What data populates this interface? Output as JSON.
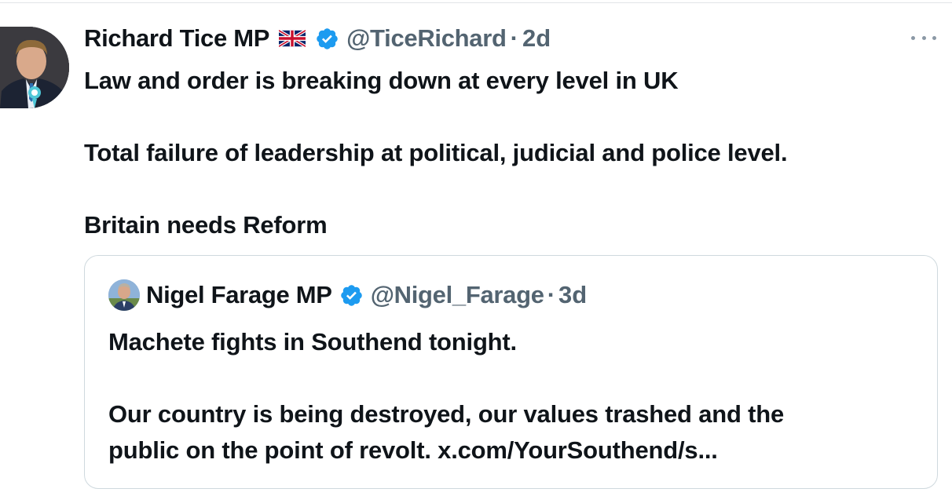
{
  "tweet": {
    "author_name": "Richard Tice MP",
    "handle": "@TiceRichard",
    "separator": "·",
    "time": "2d",
    "flag_icon": "uk-flag-icon",
    "verified_icon": "verified-badge-icon",
    "verified_color": "#1d9bf0",
    "more_icon": "more-options-icon",
    "text_lines": [
      "Law and order is breaking down at every level in UK",
      "Total failure of leadership at political, judicial and police level.",
      "Britain needs Reform"
    ]
  },
  "quote": {
    "author_name": "Nigel Farage MP",
    "handle": "@Nigel_Farage",
    "separator": "·",
    "time": "3d",
    "verified_icon": "verified-badge-icon",
    "text_lines": [
      "Machete fights in Southend tonight.",
      "Our country is being destroyed, our values trashed and the",
      "public on the point of revolt. x.com/YourSouthend/s..."
    ]
  },
  "colors": {
    "text": "#0f1419",
    "secondary_text": "#536471",
    "border": "#cfd9de",
    "verified": "#1d9bf0"
  }
}
